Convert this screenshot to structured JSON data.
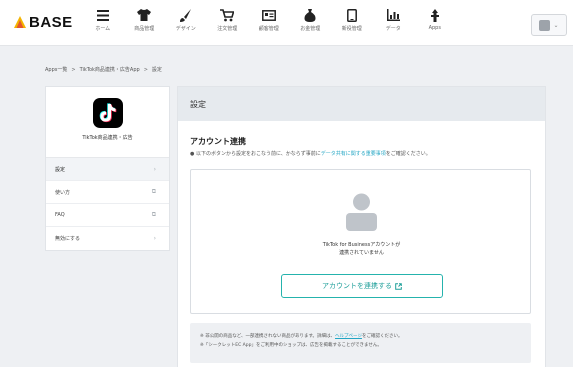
{
  "header": {
    "brand": "BASE",
    "nav": [
      {
        "label": "ホーム",
        "icon": "menu-icon"
      },
      {
        "label": "商品管理",
        "icon": "shirt-icon"
      },
      {
        "label": "デザイン",
        "icon": "brush-icon"
      },
      {
        "label": "注文管理",
        "icon": "cart-icon"
      },
      {
        "label": "顧客管理",
        "icon": "customer-card-icon"
      },
      {
        "label": "お金管理",
        "icon": "money-bag-icon"
      },
      {
        "label": "新役管理",
        "icon": "phone-icon"
      },
      {
        "label": "データ",
        "icon": "bar-chart-icon"
      },
      {
        "label": "Apps",
        "icon": "apps-icon"
      }
    ]
  },
  "breadcrumb": {
    "items": [
      "Apps一覧",
      "TikTok商品連携・広告App",
      "設定"
    ],
    "separator": ">"
  },
  "sidebar": {
    "app_name": "TikTok商品連携・広告",
    "items": [
      {
        "label": "設定",
        "arrow": "›"
      },
      {
        "label": "使い方",
        "arrow": "⧉"
      },
      {
        "label": "FAQ",
        "arrow": "⧉"
      },
      {
        "label": "無効にする",
        "arrow": "›"
      }
    ]
  },
  "main": {
    "header_title": "設定",
    "section_title": "アカウント連携",
    "desc_prefix": "● 以下のボタンから設定をおこなう前に、かならず事前に",
    "desc_link": "データ共有に関する重要事項",
    "desc_suffix": "をご確認ください。",
    "connect_msg_line1": "TikTok for Businessアカウントが",
    "connect_msg_line2": "連携されていません",
    "connect_button": "アカウントを連携する",
    "notes": {
      "line1_prefix": "※ 非公開の商品など、一部連携されない商品があります。詳細は、",
      "line1_link": "ヘルプページ",
      "line1_suffix": "をご確認ください。",
      "line2": "※「シークレットEC App」をご利用中のショップは、広告を掲載することができません。"
    }
  },
  "colors": {
    "accent": "#25b3ad",
    "link": "#23a6c4",
    "header_bg": "#e6eaee",
    "page_bg": "#eef0f3"
  }
}
